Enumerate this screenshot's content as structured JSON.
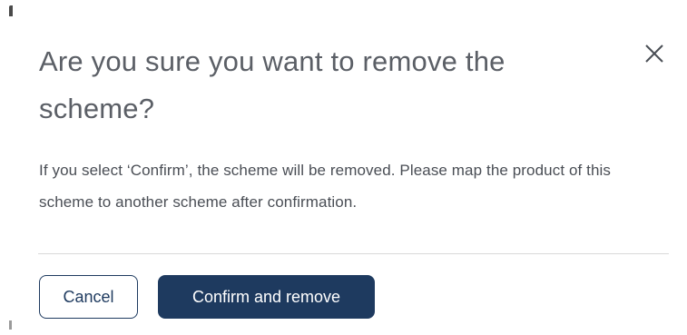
{
  "dialog": {
    "title": "Are you sure you want to remove the scheme?",
    "message": "If you select ‘Confirm’, the scheme will be removed. Please map the product of this scheme to another scheme after confirmation.",
    "close_icon": "close-icon",
    "buttons": {
      "cancel_label": "Cancel",
      "confirm_label": "Confirm and remove"
    }
  },
  "colors": {
    "primary": "#1e3a5f",
    "title_text": "#5b5f66",
    "body_text": "#4a4e55",
    "divider": "#d9d9d9",
    "background": "#ffffff"
  }
}
